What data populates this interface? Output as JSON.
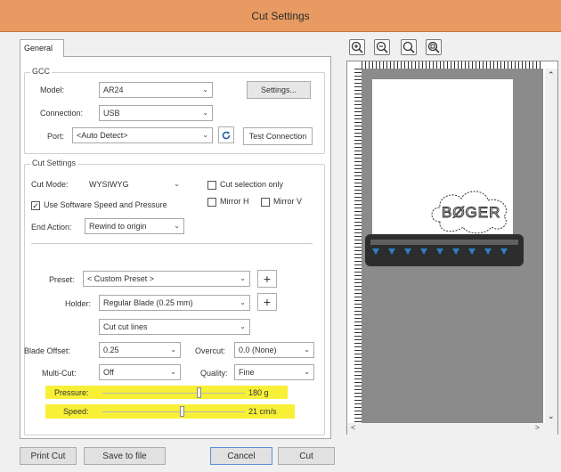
{
  "window": {
    "title": "Cut Settings"
  },
  "tabs": [
    {
      "label": "General"
    }
  ],
  "gcc": {
    "group_label": "GCC",
    "model_label": "Model:",
    "model_value": "AR24",
    "settings_button": "Settings...",
    "connection_label": "Connection:",
    "connection_value": "USB",
    "port_label": "Port:",
    "port_value": "<Auto Detect>",
    "test_connection_button": "Test Connection"
  },
  "cut_settings": {
    "group_label": "Cut Settings",
    "cut_mode_label": "Cut Mode:",
    "cut_mode_value": "WYSIWYG",
    "cut_selection_only": "Cut selection only",
    "use_software_speed": "Use Software Speed and Pressure",
    "mirror_h": "Mirror H",
    "mirror_v": "Mirror V",
    "end_action_label": "End Action:",
    "end_action_value": "Rewind to origin"
  },
  "preset": {
    "preset_label": "Preset:",
    "preset_value": "< Custom Preset >",
    "holder_label": "Holder:",
    "holder_value": "Regular Blade (0.25 mm)",
    "cut_lines_value": "Cut cut lines",
    "blade_offset_label": "Blade Offset:",
    "blade_offset_value": "0.25",
    "overcut_label": "Overcut:",
    "overcut_value": "0.0 (None)",
    "multicut_label": "Multi-Cut:",
    "multicut_value": "Off",
    "quality_label": "Quality:",
    "quality_value": "Fine",
    "pressure_label": "Pressure:",
    "pressure_value": "180 g",
    "pressure_level": 0.68,
    "speed_label": "Speed:",
    "speed_value": "21 cm/s",
    "speed_level": 0.56
  },
  "footer": {
    "print_cut": "Print Cut",
    "save_to_file": "Save to file",
    "cancel": "Cancel",
    "cut": "Cut"
  },
  "preview": {
    "cloud_text": "BØGER"
  },
  "colors": {
    "titlebar": "#e79b62",
    "highlight": "#f8ef2c",
    "blade_arrows": "#2e7cc4"
  }
}
